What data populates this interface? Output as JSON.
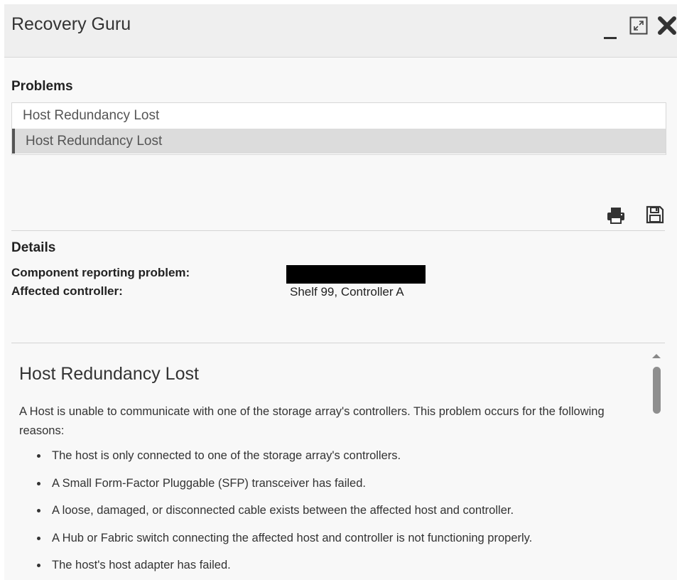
{
  "window": {
    "title": "Recovery Guru",
    "controls": [
      "minimize-icon",
      "maximize-icon",
      "close-icon"
    ]
  },
  "problems": {
    "label": "Problems",
    "items": [
      {
        "label": "Host Redundancy Lost",
        "selected": false
      },
      {
        "label": "Host Redundancy Lost",
        "selected": true
      }
    ]
  },
  "toolbar": {
    "icons": [
      "print-icon",
      "save-icon"
    ]
  },
  "details": {
    "label": "Details",
    "rows": [
      {
        "key": "Component reporting problem:",
        "value": "",
        "redacted": true
      },
      {
        "key": "Affected controller:",
        "value": "Shelf 99, Controller A"
      }
    ]
  },
  "content": {
    "title": "Host Redundancy Lost",
    "description": "A Host is unable to communicate with one of the storage array's controllers. This problem occurs for the following reasons:",
    "reasons": [
      "The host is only connected to one of the storage array's controllers.",
      "A Small Form-Factor Pluggable (SFP) transceiver has failed.",
      "A loose, damaged, or disconnected cable exists between the affected host and controller.",
      "A Hub or Fabric switch connecting the affected host and controller is not functioning properly.",
      "The host's host adapter has failed."
    ]
  },
  "colors": {
    "titlebar": "#efefef",
    "selected_row": "#dcdcdc",
    "selection_bar": "#555555"
  }
}
